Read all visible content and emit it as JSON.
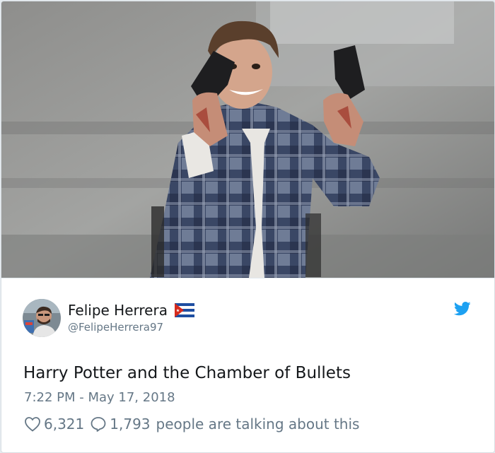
{
  "tweet": {
    "author_name": "Felipe Herrera",
    "author_handle": "@FelipeHerrera97",
    "text": "Harry Potter and the Chamber of Bullets",
    "timestamp": "7:22 PM - May 17, 2018",
    "likes": "6,321",
    "replies": "1,793",
    "talking_text": "people are talking about this"
  },
  "icons": {
    "like": "heart-icon",
    "reply": "speech-bubble-icon",
    "brand": "twitter-bird-icon",
    "flag": "cuba-flag-icon"
  },
  "colors": {
    "twitter_blue": "#1da1f2",
    "text_primary": "#14171a",
    "text_secondary": "#657786"
  }
}
